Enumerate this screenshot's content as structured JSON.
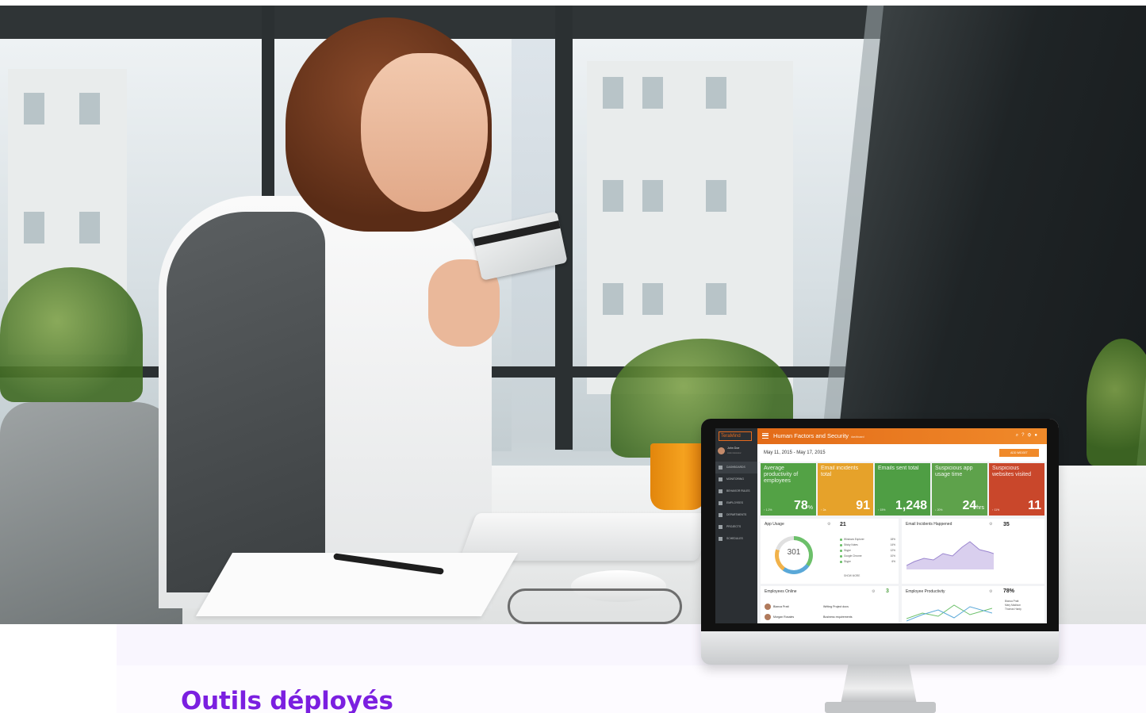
{
  "section": {
    "title": "Outils déployés"
  },
  "dashboard": {
    "logo": "TeraMind",
    "user": {
      "name": "John Doe",
      "role": "Administrator"
    },
    "nav": [
      {
        "label": "DASHBOARDS",
        "active": true
      },
      {
        "label": "MONITORING",
        "active": false
      },
      {
        "label": "BEHAVIOR RULES",
        "active": false
      },
      {
        "label": "EMPLOYEES",
        "active": false
      },
      {
        "label": "DEPARTMENTS",
        "active": false
      },
      {
        "label": "PROJECTS",
        "active": false
      },
      {
        "label": "SCHEDULES",
        "active": false
      }
    ],
    "header": {
      "title": "Human Factors and Security",
      "subtitle": "dashboard"
    },
    "date_range": "May 11, 2015 - May 17, 2015",
    "add_button": "ADD WIDGET",
    "tiles": [
      {
        "label": "Average productivity of employees",
        "trend": "↑ 1.2%",
        "value": "78",
        "unit": "%",
        "color": "#53a245"
      },
      {
        "label": "Email incidents total",
        "trend": "↑ 2a",
        "value": "91",
        "unit": "",
        "color": "#e6a22a"
      },
      {
        "label": "Emails sent total",
        "trend": "↑ 15%",
        "value": "1,248",
        "unit": "",
        "color": "#4f9e44"
      },
      {
        "label": "Suspicious app usage time",
        "trend": "↓ 20%",
        "value": "24",
        "unit": "hrs",
        "color": "#5ea24b"
      },
      {
        "label": "Suspicious websites visited",
        "trend": "↑ 11%",
        "value": "11",
        "unit": "",
        "color": "#c9472b"
      }
    ],
    "app_usage": {
      "title": "App Usage",
      "donut_value": "301",
      "total": "21",
      "apps": [
        {
          "name": "Windows Explorer",
          "pct": "18%"
        },
        {
          "name": "Sticky Notes",
          "pct": "14%"
        },
        {
          "name": "Skype",
          "pct": "12%"
        },
        {
          "name": "Google Chrome",
          "pct": "10%"
        },
        {
          "name": "Skype",
          "pct": "6%"
        }
      ],
      "show_more": "SHOW MORE"
    },
    "email_incidents": {
      "title": "Email Incidents Happened",
      "count": "35"
    },
    "employees_online": {
      "title": "Employees Online",
      "count": "3",
      "rows": [
        {
          "name": "Bianca Pratt",
          "task": "Writing Project docs"
        },
        {
          "name": "Morgan Rosales",
          "task": "Business requirements"
        }
      ]
    },
    "employee_productivity": {
      "title": "Employee Productivity",
      "pct": "78%",
      "people": [
        "Bianca Pratt",
        "Mary Madison",
        "Thomas Hardy"
      ]
    }
  }
}
